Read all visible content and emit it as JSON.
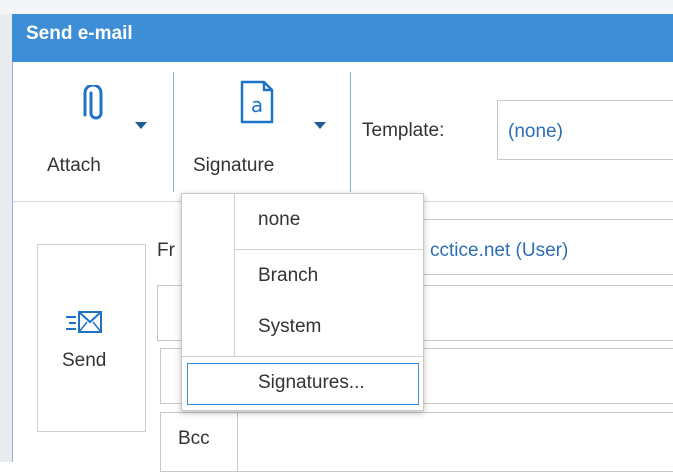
{
  "window": {
    "title": "Send e-mail"
  },
  "toolbar": {
    "attach_label": "Attach",
    "attach_icon": "paperclip-icon",
    "signature_label": "Signature",
    "signature_icon": "document-a-icon",
    "template_label": "Template:",
    "template_value": "(none)"
  },
  "send": {
    "label": "Send",
    "icon": "envelope-send-icon"
  },
  "form": {
    "from_label": "Fr",
    "from_value": "cctice.net (User)",
    "bcc_label": "Bcc"
  },
  "signature_menu": {
    "items": [
      "none",
      "Branch",
      "System",
      "Signatures..."
    ]
  },
  "colors": {
    "titlebar": "#3d8ed6",
    "link_text": "#2d6db5",
    "icon": "#1f73c4"
  }
}
